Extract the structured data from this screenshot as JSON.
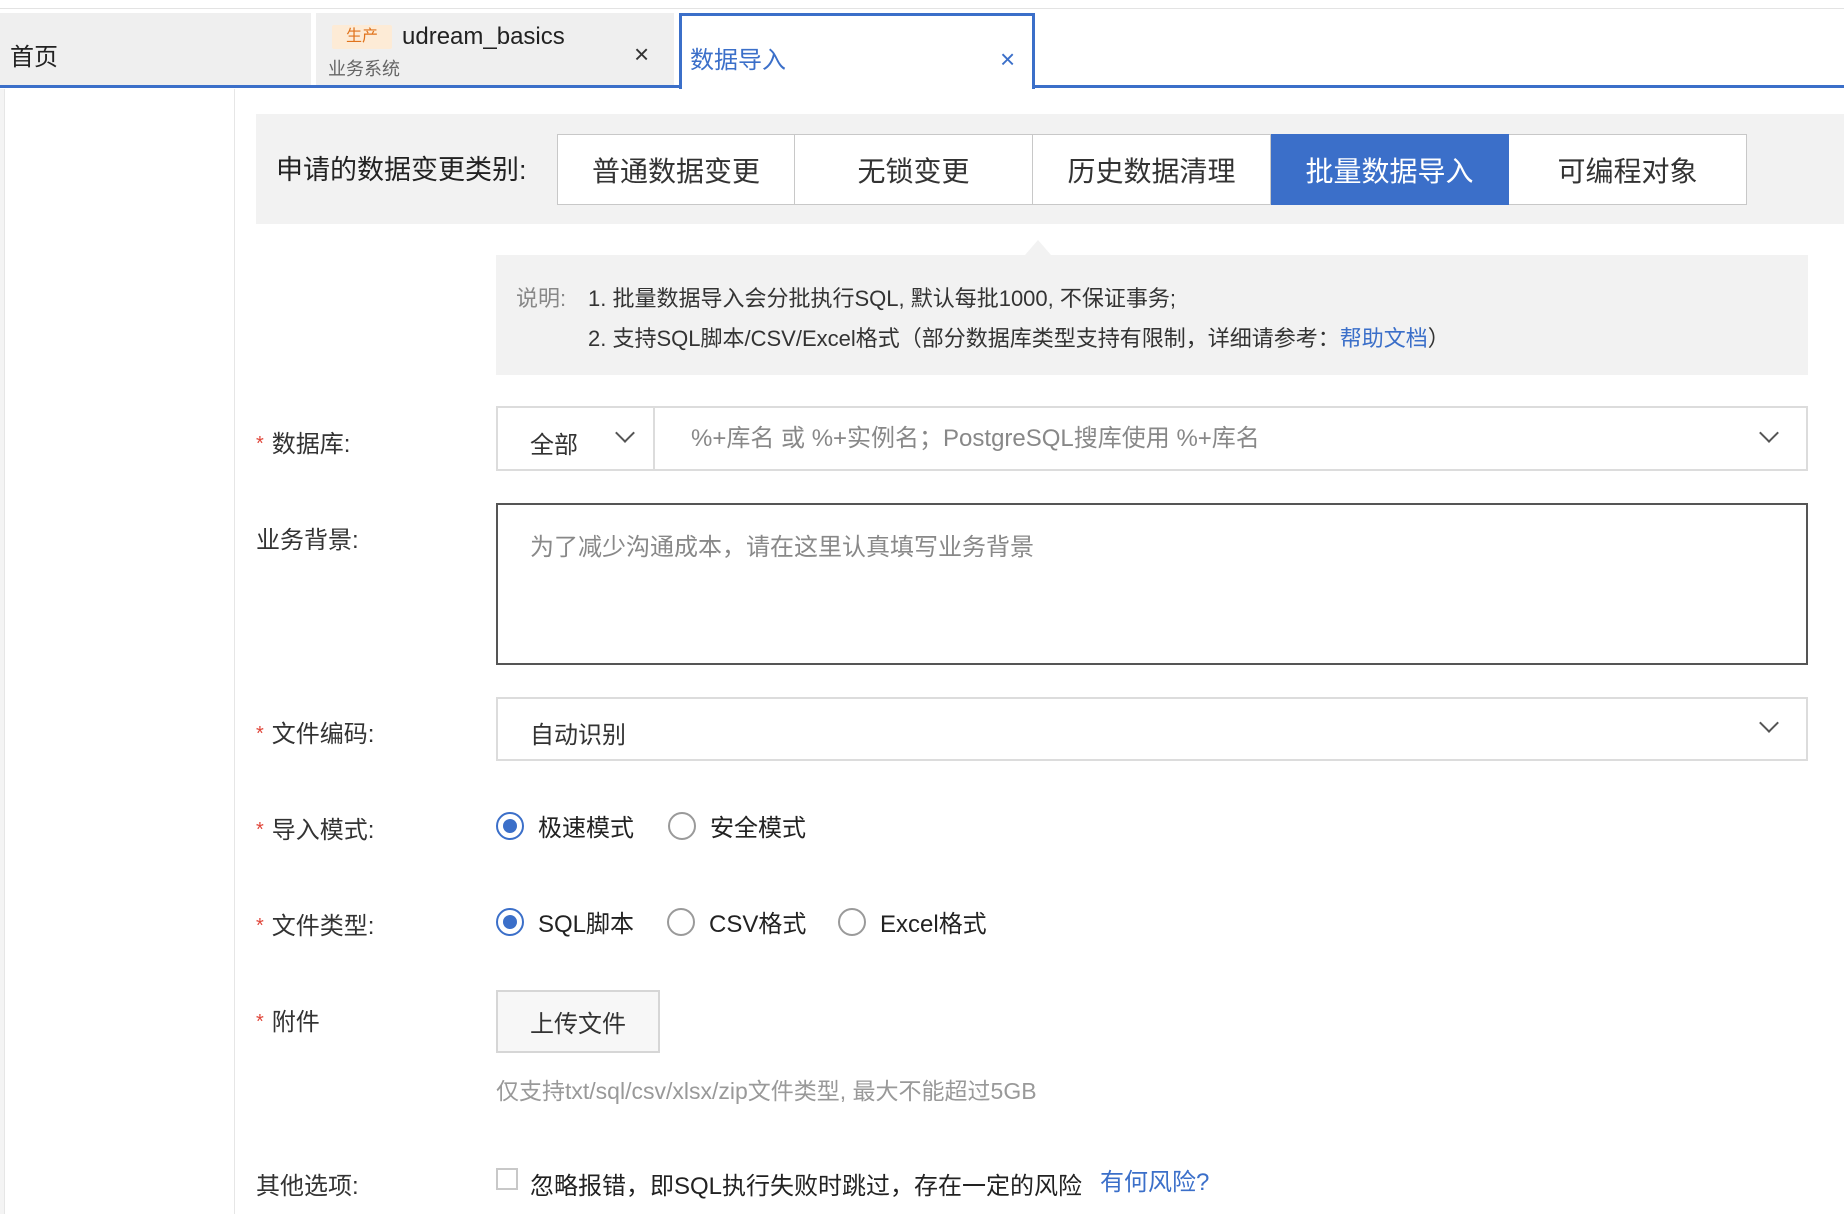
{
  "tabs": {
    "home": {
      "title": "首页"
    },
    "business": {
      "env_badge": "生产",
      "title": "udream_basics",
      "subtitle": "业务系统",
      "close": "×"
    },
    "active": {
      "title": "数据导入",
      "close": "×"
    }
  },
  "category": {
    "label": "申请的数据变更类别:",
    "options": [
      "普通数据变更",
      "无锁变更",
      "历史数据清理",
      "批量数据导入",
      "可编程对象"
    ],
    "selected": "批量数据导入"
  },
  "notice": {
    "label": "说明:",
    "line1": "1. 批量数据导入会分批执行SQL, 默认每批1000, 不保证事务;",
    "line2_prefix": "2. 支持SQL脚本/CSV/Excel格式（部分数据库类型支持有限制，详细请参考：",
    "line2_link": "帮助文档",
    "line2_suffix": "）"
  },
  "form": {
    "database": {
      "label": "数据库:",
      "scope_value": "全部",
      "search_placeholder": "%+库名 或 %+实例名；PostgreSQL搜库使用 %+库名"
    },
    "business_background": {
      "label": "业务背景:",
      "placeholder": "为了减少沟通成本，请在这里认真填写业务背景"
    },
    "file_encoding": {
      "label": "文件编码:",
      "value": "自动识别"
    },
    "import_mode": {
      "label": "导入模式:",
      "options": [
        "极速模式",
        "安全模式"
      ],
      "selected": "极速模式"
    },
    "file_type": {
      "label": "文件类型:",
      "options": [
        "SQL脚本",
        "CSV格式",
        "Excel格式"
      ],
      "selected": "SQL脚本"
    },
    "attachment": {
      "label": "附件",
      "upload_label": "上传文件",
      "hint": "仅支持txt/sql/csv/xlsx/zip文件类型, 最大不能超过5GB"
    },
    "other_options": {
      "label": "其他选项:",
      "ignore_errors_label": "忽略报错，即SQL执行失败时跳过，存在一定的风险",
      "ignore_errors_checked": false,
      "risk_link": "有何风险?"
    },
    "required_mark": "*"
  },
  "colors": {
    "accent": "#3b6fc9",
    "required": "#e0463a",
    "env_badge_text": "#e0731c",
    "env_badge_bg": "#fdebd6",
    "panel_bg": "#f2f2f2"
  }
}
